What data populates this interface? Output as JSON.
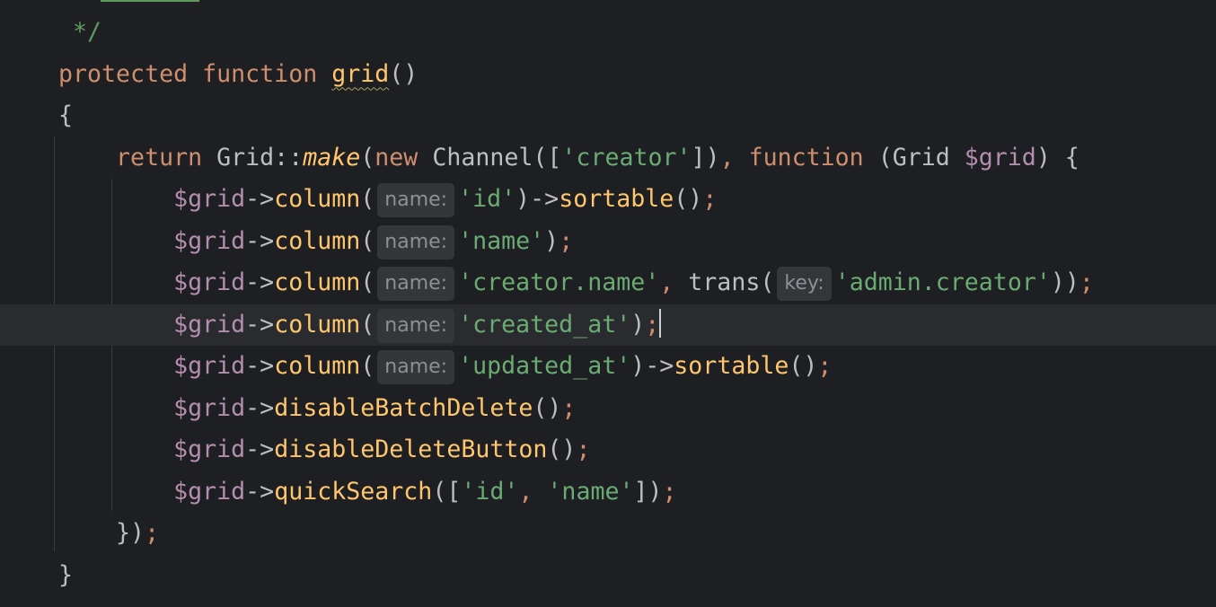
{
  "editor": {
    "current_line": 7,
    "lines": [
      {
        "tokens": [
          {
            "t": " */",
            "c": "cm"
          }
        ]
      },
      {
        "tokens": [
          {
            "t": "protected",
            "c": "kw"
          },
          {
            "t": " ",
            "c": "pl"
          },
          {
            "t": "function",
            "c": "kw"
          },
          {
            "t": " ",
            "c": "pl"
          },
          {
            "t": "grid",
            "c": "fn warn"
          },
          {
            "t": "()",
            "c": "pl"
          }
        ]
      },
      {
        "tokens": [
          {
            "t": "{",
            "c": "pl"
          }
        ]
      },
      {
        "tokens": [
          {
            "t": "    ",
            "c": "pl"
          },
          {
            "t": "return",
            "c": "kw"
          },
          {
            "t": " Grid::",
            "c": "pl"
          },
          {
            "t": "make",
            "c": "it"
          },
          {
            "t": "(",
            "c": "pl"
          },
          {
            "t": "new",
            "c": "kw"
          },
          {
            "t": " Channel([",
            "c": "pl"
          },
          {
            "t": "'creator'",
            "c": "str"
          },
          {
            "t": "])",
            "c": "pl"
          },
          {
            "t": ", ",
            "c": "semi"
          },
          {
            "t": "function",
            "c": "kw"
          },
          {
            "t": " (Grid ",
            "c": "pl"
          },
          {
            "t": "$grid",
            "c": "var"
          },
          {
            "t": ") {",
            "c": "pl"
          }
        ]
      },
      {
        "tokens": [
          {
            "t": "        ",
            "c": "pl"
          },
          {
            "t": "$grid",
            "c": "var"
          },
          {
            "t": "->",
            "c": "pl"
          },
          {
            "t": "column",
            "c": "fn"
          },
          {
            "t": "(",
            "c": "pl"
          },
          {
            "t": "name:",
            "c": "hint"
          },
          {
            "t": "'id'",
            "c": "str"
          },
          {
            "t": ")->",
            "c": "pl"
          },
          {
            "t": "sortable",
            "c": "fn"
          },
          {
            "t": "()",
            "c": "pl"
          },
          {
            "t": ";",
            "c": "semi"
          }
        ]
      },
      {
        "tokens": [
          {
            "t": "        ",
            "c": "pl"
          },
          {
            "t": "$grid",
            "c": "var"
          },
          {
            "t": "->",
            "c": "pl"
          },
          {
            "t": "column",
            "c": "fn"
          },
          {
            "t": "(",
            "c": "pl"
          },
          {
            "t": "name:",
            "c": "hint"
          },
          {
            "t": "'name'",
            "c": "str"
          },
          {
            "t": ")",
            "c": "pl"
          },
          {
            "t": ";",
            "c": "semi"
          }
        ]
      },
      {
        "tokens": [
          {
            "t": "        ",
            "c": "pl"
          },
          {
            "t": "$grid",
            "c": "var"
          },
          {
            "t": "->",
            "c": "pl"
          },
          {
            "t": "column",
            "c": "fn"
          },
          {
            "t": "(",
            "c": "pl"
          },
          {
            "t": "name:",
            "c": "hint"
          },
          {
            "t": "'creator.name'",
            "c": "str"
          },
          {
            "t": ", ",
            "c": "semi"
          },
          {
            "t": "trans(",
            "c": "pl"
          },
          {
            "t": "key:",
            "c": "hint"
          },
          {
            "t": "'admin.creator'",
            "c": "str"
          },
          {
            "t": "))",
            "c": "pl"
          },
          {
            "t": ";",
            "c": "semi"
          }
        ]
      },
      {
        "tokens": [
          {
            "t": "        ",
            "c": "pl"
          },
          {
            "t": "$grid",
            "c": "var"
          },
          {
            "t": "->",
            "c": "pl"
          },
          {
            "t": "column",
            "c": "fn"
          },
          {
            "t": "(",
            "c": "pl"
          },
          {
            "t": "name:",
            "c": "hint"
          },
          {
            "t": "'created_at'",
            "c": "str"
          },
          {
            "t": ")",
            "c": "pl"
          },
          {
            "t": ";",
            "c": "semi"
          },
          {
            "t": "",
            "c": "caret"
          }
        ]
      },
      {
        "tokens": [
          {
            "t": "        ",
            "c": "pl"
          },
          {
            "t": "$grid",
            "c": "var"
          },
          {
            "t": "->",
            "c": "pl"
          },
          {
            "t": "column",
            "c": "fn"
          },
          {
            "t": "(",
            "c": "pl"
          },
          {
            "t": "name:",
            "c": "hint"
          },
          {
            "t": "'updated_at'",
            "c": "str"
          },
          {
            "t": ")->",
            "c": "pl"
          },
          {
            "t": "sortable",
            "c": "fn"
          },
          {
            "t": "()",
            "c": "pl"
          },
          {
            "t": ";",
            "c": "semi"
          }
        ]
      },
      {
        "tokens": [
          {
            "t": "        ",
            "c": "pl"
          },
          {
            "t": "$grid",
            "c": "var"
          },
          {
            "t": "->",
            "c": "pl"
          },
          {
            "t": "disableBatchDelete",
            "c": "fn"
          },
          {
            "t": "()",
            "c": "pl"
          },
          {
            "t": ";",
            "c": "semi"
          }
        ]
      },
      {
        "tokens": [
          {
            "t": "        ",
            "c": "pl"
          },
          {
            "t": "$grid",
            "c": "var"
          },
          {
            "t": "->",
            "c": "pl"
          },
          {
            "t": "disableDeleteButton",
            "c": "fn"
          },
          {
            "t": "()",
            "c": "pl"
          },
          {
            "t": ";",
            "c": "semi"
          }
        ]
      },
      {
        "tokens": [
          {
            "t": "        ",
            "c": "pl"
          },
          {
            "t": "$grid",
            "c": "var"
          },
          {
            "t": "->",
            "c": "pl"
          },
          {
            "t": "quickSearch",
            "c": "fn"
          },
          {
            "t": "([",
            "c": "pl"
          },
          {
            "t": "'id'",
            "c": "str"
          },
          {
            "t": ", ",
            "c": "semi"
          },
          {
            "t": "'name'",
            "c": "str"
          },
          {
            "t": "])",
            "c": "pl"
          },
          {
            "t": ";",
            "c": "semi"
          }
        ]
      },
      {
        "tokens": [
          {
            "t": "    ",
            "c": "pl"
          },
          {
            "t": "})",
            "c": "pl"
          },
          {
            "t": ";",
            "c": "semi"
          }
        ]
      },
      {
        "tokens": [
          {
            "t": "}",
            "c": "pl"
          }
        ]
      }
    ]
  },
  "colors": {
    "background": "#1e1f22",
    "keyword": "#cf8e6d",
    "method": "#ffc66d",
    "variable": "#b48ead",
    "string": "#6aab73",
    "comment": "#5f9a5f",
    "hint_bg": "#35363a"
  }
}
